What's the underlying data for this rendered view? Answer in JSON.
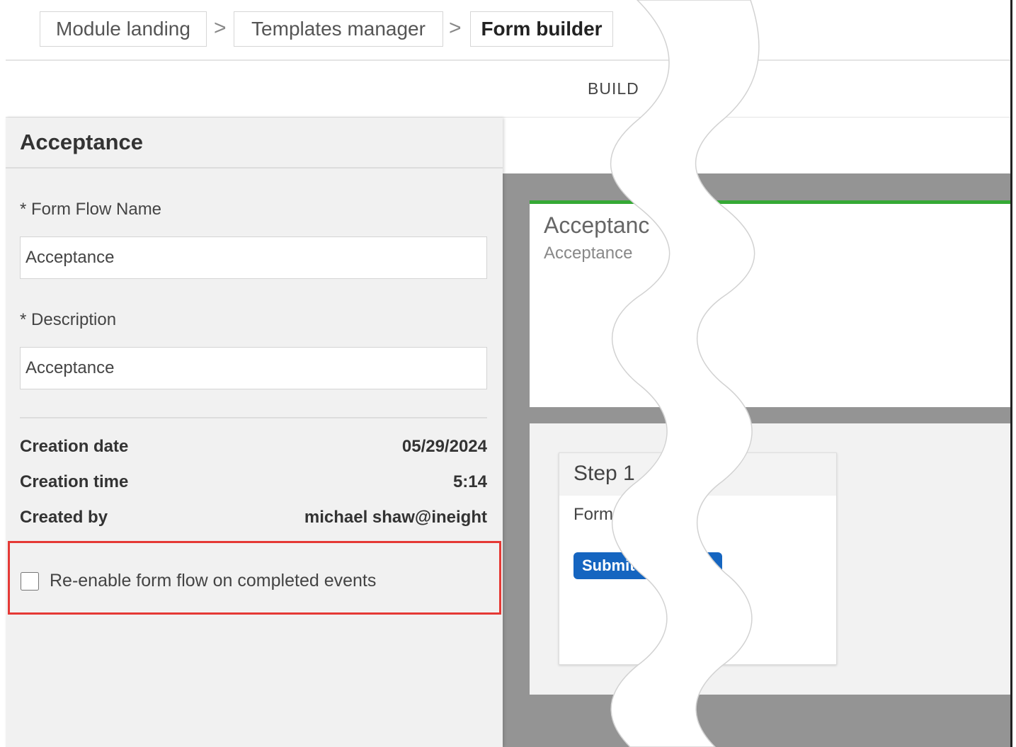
{
  "breadcrumb": {
    "items": [
      "Module landing",
      "Templates manager",
      "Form builder"
    ],
    "separator": ">"
  },
  "tabs": {
    "builder": "BUILD"
  },
  "panel": {
    "title": "Acceptance",
    "form_flow_name": {
      "label": "* Form Flow Name",
      "value": "Acceptance"
    },
    "description": {
      "label": "* Description",
      "value": "Acceptance"
    },
    "meta": [
      {
        "key": "Creation date",
        "value": "05/29/2024"
      },
      {
        "key": "Creation time",
        "value": "5:14"
      },
      {
        "key": "Created by",
        "value": "michael shaw@ineight"
      }
    ],
    "reenable_checkbox": {
      "label": "Re-enable form flow on completed events",
      "checked": false
    }
  },
  "canvas": {
    "card": {
      "title": "Acceptanc",
      "subtitle": "Acceptance"
    },
    "step": {
      "title": "Step 1",
      "form_label": "Form",
      "submit_label": "Submit t"
    }
  },
  "colors": {
    "accent_green": "#35a935",
    "button_blue": "#1565c0",
    "highlight_red": "#e53935",
    "canvas_gray": "#949494",
    "panel_bg": "#f1f1f1"
  }
}
